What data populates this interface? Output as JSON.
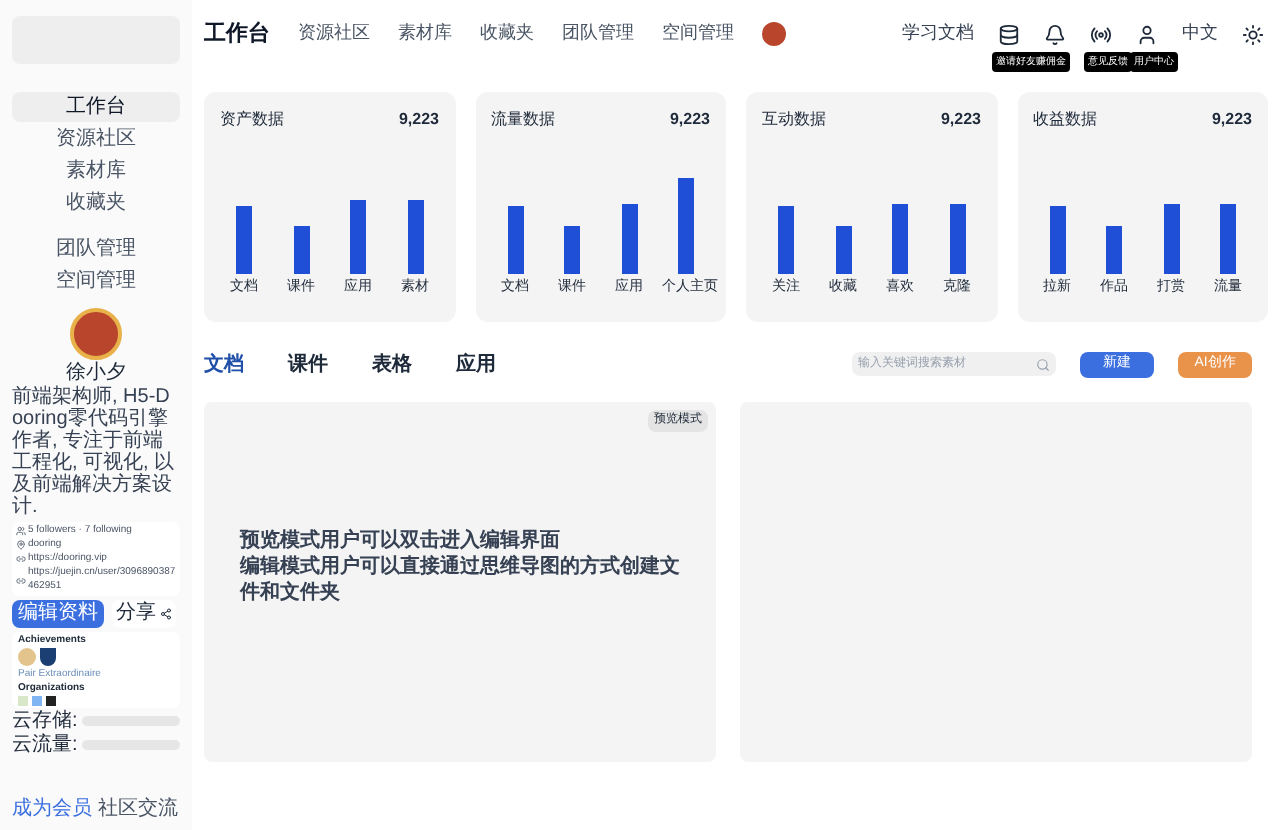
{
  "sidebar": {
    "nav": [
      {
        "label": "工作台",
        "selected": true
      },
      {
        "label": "资源社区",
        "selected": false
      },
      {
        "label": "素材库",
        "selected": false
      },
      {
        "label": "收藏夹",
        "selected": false
      }
    ],
    "nav_team": [
      {
        "label": "团队管理",
        "selected": false
      },
      {
        "label": "空间管理",
        "selected": false
      }
    ],
    "profile": {
      "name": "徐小夕",
      "bio": "前端架构师, H5-Dooring零代码引擎作者, 专注于前端工程化, 可视化, 以及前端解决方案设计.",
      "stats": "5 followers · 7 following",
      "links": [
        "dooring",
        "https://dooring.vip",
        "https://juejin.cn/user/3096890387462951"
      ],
      "edit_button": "编辑资料",
      "share_button": "分享",
      "achievements_title": "Achievements",
      "achievement_caption": "Pair Extraordinaire",
      "organizations_title": "Organizations"
    },
    "storage": [
      {
        "label": "云存储:"
      },
      {
        "label": "云流量:"
      }
    ],
    "footer": [
      "成为会员",
      "社区交流"
    ]
  },
  "top_nav": {
    "items": [
      {
        "label": "工作台",
        "selected": true
      },
      {
        "label": "资源社区",
        "selected": false
      },
      {
        "label": "素材库",
        "selected": false
      },
      {
        "label": "收藏夹",
        "selected": false
      },
      {
        "label": "团队管理",
        "selected": false
      },
      {
        "label": "空间管理",
        "selected": false
      }
    ],
    "docs_link": "学习文档",
    "icons": [
      {
        "kind": "database",
        "tooltip": "邀请好友赚佣金"
      },
      {
        "kind": "bell"
      },
      {
        "kind": "broadcast",
        "tooltip": "意见反馈"
      },
      {
        "kind": "user",
        "tooltip": "用户中心"
      }
    ],
    "language": "中文"
  },
  "stat_cards": [
    {
      "title": "资产数据",
      "value": "9,223",
      "categories": [
        "文档",
        "课件",
        "应用",
        "素材"
      ]
    },
    {
      "title": "流量数据",
      "value": "9,223",
      "categories": [
        "文档",
        "课件",
        "应用",
        "个人主页"
      ]
    },
    {
      "title": "互动数据",
      "value": "9,223",
      "categories": [
        "关注",
        "收藏",
        "喜欢",
        "克隆"
      ]
    },
    {
      "title": "收益数据",
      "value": "9,223",
      "categories": [
        "拉新",
        "作品",
        "打赏",
        "流量"
      ]
    }
  ],
  "tabs": [
    {
      "label": "文档",
      "selected": true
    },
    {
      "label": "课件",
      "selected": false
    },
    {
      "label": "表格",
      "selected": false
    },
    {
      "label": "应用",
      "selected": false
    }
  ],
  "search": {
    "placeholder": "输入关键词搜索素材"
  },
  "buttons": [
    {
      "kind": "primary",
      "label": "新建"
    },
    {
      "kind": "ai",
      "label": "AI创作"
    }
  ],
  "panels": [
    {
      "kind": "preview",
      "badge": "预览模式",
      "lines": [
        "预览模式用户可以双击进入编辑界面",
        "编辑模式用户可以直接通过思维导图的方式创建文件和文件夹"
      ]
    },
    {
      "kind": "empty"
    }
  ]
}
